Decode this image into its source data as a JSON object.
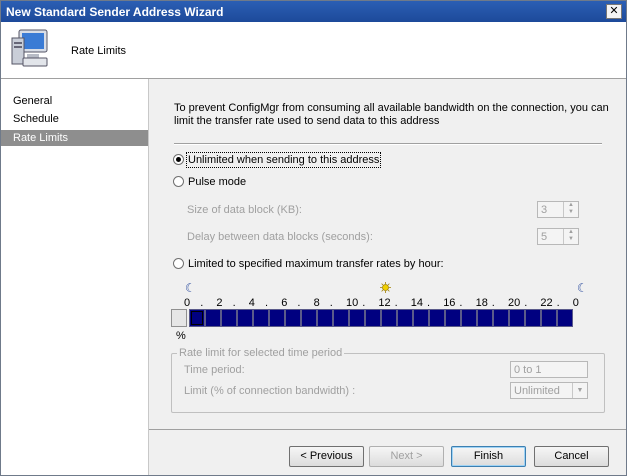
{
  "window": {
    "title": "New Standard Sender Address Wizard",
    "close_glyph": "✕"
  },
  "header": {
    "title": "Rate Limits",
    "icon": "computer-icon"
  },
  "sidebar": {
    "items": [
      {
        "label": "General"
      },
      {
        "label": "Schedule"
      },
      {
        "label": "Rate Limits",
        "selected": true
      }
    ]
  },
  "main": {
    "description": "To prevent ConfigMgr from consuming all available bandwidth on the connection, you can  limit the transfer rate used to send data to this address",
    "option_unlimited": "Unlimited when sending to this address",
    "option_pulse": "Pulse mode",
    "pulse": {
      "block_size_label": "Size of data block (KB):",
      "block_size_value": "3",
      "delay_label": "Delay between data blocks (seconds):",
      "delay_value": "5"
    },
    "option_limited": "Limited to specified maximum transfer rates by hour:",
    "hours": {
      "tick_labels": [
        "0",
        ".",
        "2",
        ".",
        "4",
        ".",
        "6",
        ".",
        "8",
        ".",
        "10",
        ".",
        "12",
        ".",
        "14",
        ".",
        "16",
        ".",
        "18",
        ".",
        "20",
        ".",
        "22",
        ".",
        "0"
      ],
      "percent_label": "%",
      "moon_icon": "moon-icon",
      "sun_icon": "sun-icon"
    },
    "group": {
      "legend": "Rate limit for selected time period",
      "time_period_label": "Time period:",
      "time_period_value": "0 to 1",
      "limit_label": "Limit (% of connection bandwidth) :",
      "limit_value": "Unlimited"
    }
  },
  "footer": {
    "previous": "< Previous",
    "next": "Next >",
    "finish": "Finish",
    "cancel": "Cancel"
  },
  "colors": {
    "title_bar": "#1d4a9a",
    "hour_cell": "#000080",
    "selected_nav": "#8e8e8e"
  }
}
